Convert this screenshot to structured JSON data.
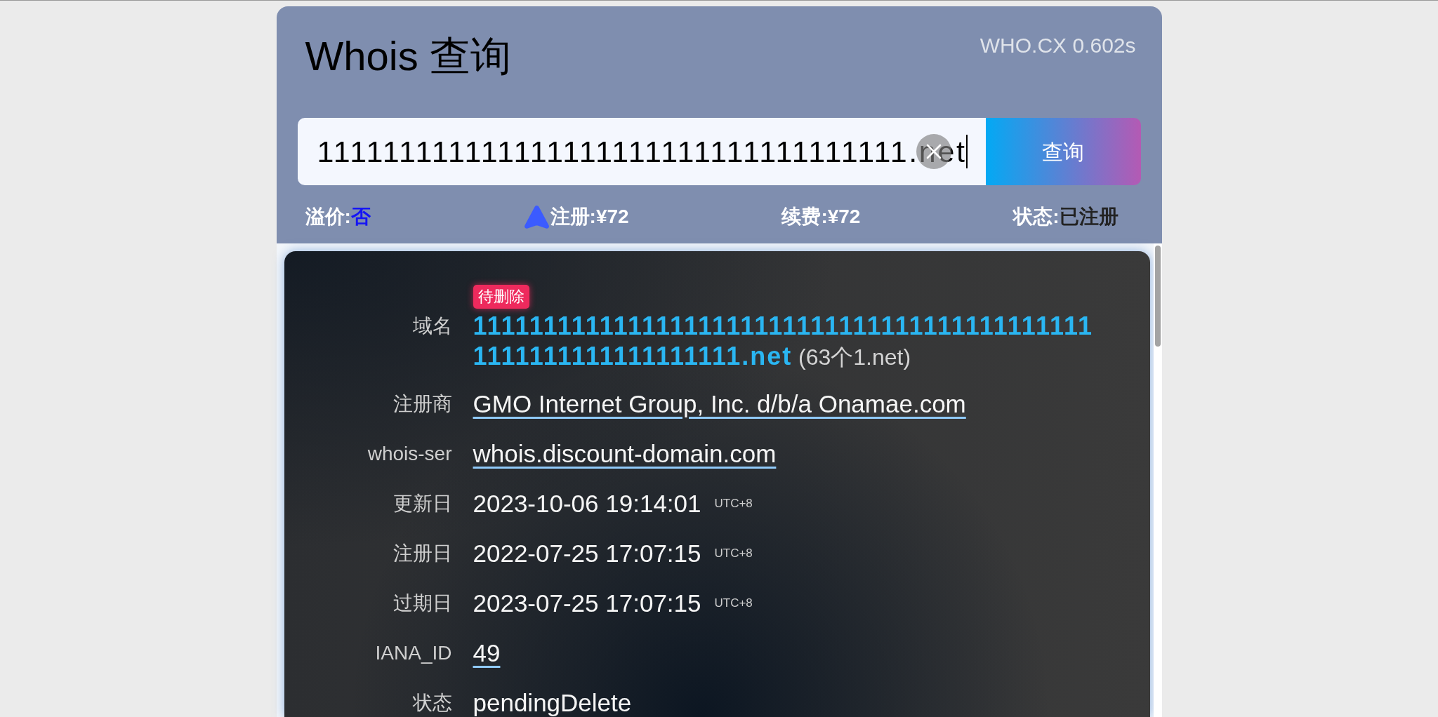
{
  "header": {
    "title": "Whois 查询",
    "timing": "WHO.CX 0.602s"
  },
  "search": {
    "value": "111111111111111111111111111111111111.net",
    "button": "查询"
  },
  "stats": [
    {
      "label": "溢价:",
      "value": "否",
      "color": "#1414f5",
      "kind": "plain"
    },
    {
      "label": "注册:",
      "value": "¥72",
      "color": "#ffffff",
      "kind": "icon"
    },
    {
      "label": "续费:",
      "value": "¥72",
      "color": "#ffffff",
      "kind": "plain"
    },
    {
      "label": "状态:",
      "value": "已注册",
      "color": "#222222",
      "kind": "plain"
    }
  ],
  "domain": {
    "tag": "待删除",
    "label": "域名",
    "value": "**111111111111111111111111111111111111111111111111111111111111111.net** (63个1.net)"
  },
  "records": [
    {
      "label": "注册商",
      "value": "GMO Internet Group, Inc. d/b/a Onamae.com",
      "kind": "link"
    },
    {
      "label": "whois-ser",
      "value": "whois.discount-domain.com",
      "kind": "link"
    },
    {
      "label": "更新日",
      "value": "2023-10-06 19:14:01",
      "zone": "UTC+8",
      "kind": "date"
    },
    {
      "label": "注册日",
      "value": "2022-07-25 17:07:15",
      "zone": "UTC+8",
      "kind": "date"
    },
    {
      "label": "过期日",
      "value": "2023-07-25 17:07:15",
      "zone": "UTC+8",
      "kind": "date"
    },
    {
      "label": "IANA_ID",
      "value": "49",
      "kind": "link"
    },
    {
      "label": "状态",
      "value": "pendingDelete",
      "kind": "text"
    }
  ]
}
